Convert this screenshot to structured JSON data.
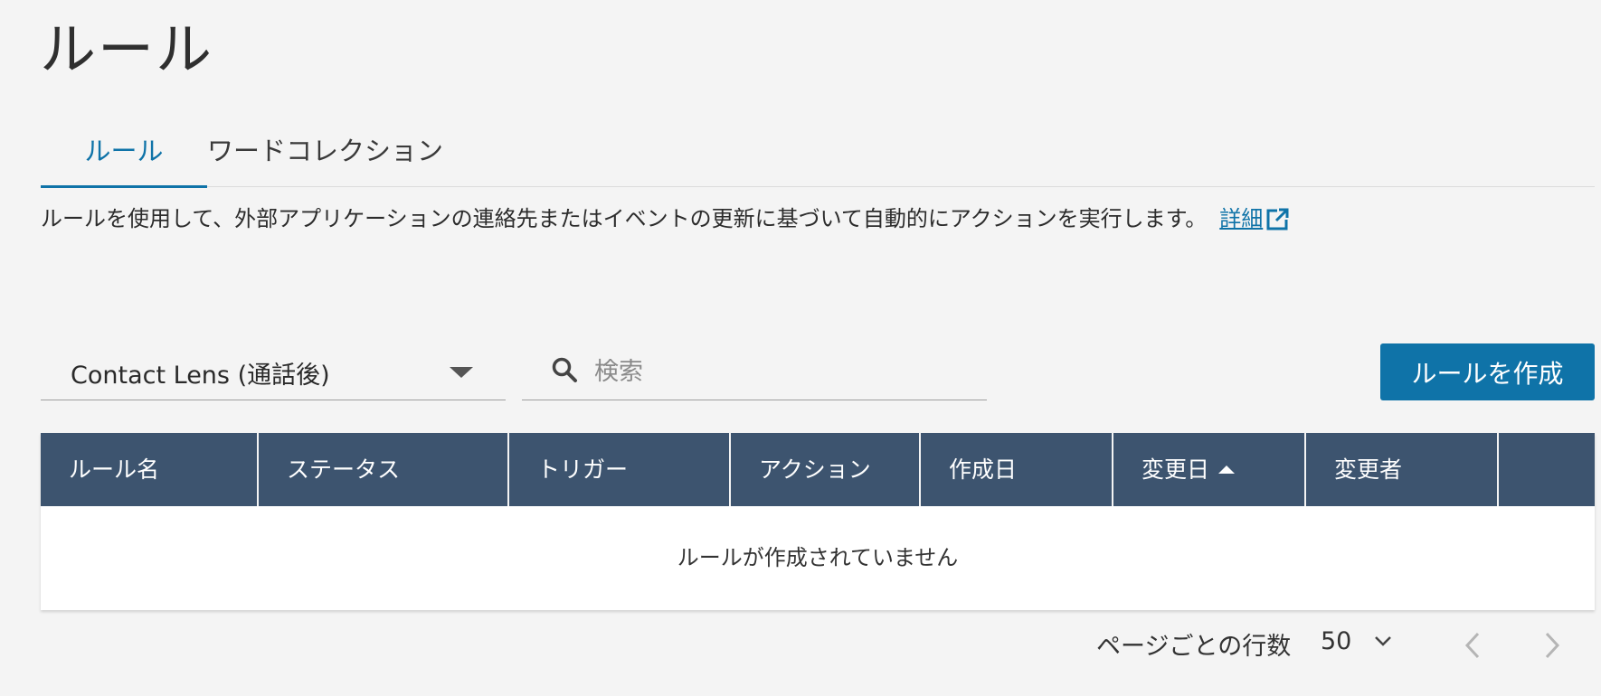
{
  "page": {
    "title": "ルール"
  },
  "tabs": [
    {
      "label": "ルール",
      "active": true
    },
    {
      "label": "ワードコレクション",
      "active": false
    }
  ],
  "description": {
    "text": "ルールを使用して、外部アプリケーションの連絡先またはイベントの更新に基づいて自動的にアクションを実行します。",
    "link_label": "詳細"
  },
  "filter": {
    "selected": "Contact Lens (通話後)"
  },
  "search": {
    "placeholder": "検索",
    "value": ""
  },
  "toolbar": {
    "create_label": "ルールを作成"
  },
  "table": {
    "columns": [
      "ルール名",
      "ステータス",
      "トリガー",
      "アクション",
      "作成日",
      "変更日",
      "変更者",
      ""
    ],
    "sorted_column": "変更日",
    "sort_direction": "ascending",
    "empty_message": "ルールが作成されていません"
  },
  "pagination": {
    "rows_label": "ページごとの行数",
    "page_size": "50"
  },
  "colors": {
    "accent": "#0f73a8",
    "header_bg": "#3d546f",
    "page_bg": "#f4f4f4"
  }
}
